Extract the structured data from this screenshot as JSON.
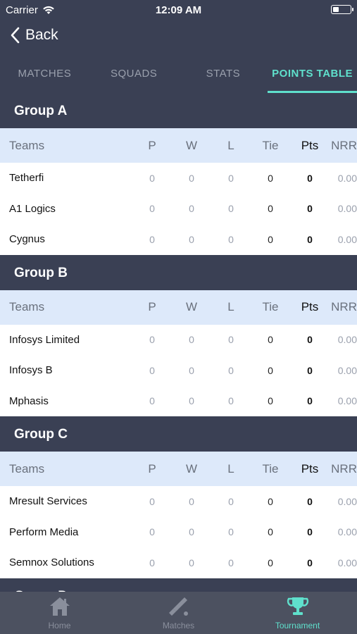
{
  "status_bar": {
    "carrier": "Carrier",
    "time": "12:09 AM"
  },
  "nav": {
    "back_label": "Back"
  },
  "tabs": [
    {
      "label": "MATCHES",
      "active": false
    },
    {
      "label": "SQUADS",
      "active": false
    },
    {
      "label": "STATS",
      "active": false
    },
    {
      "label": "POINTS TABLE",
      "active": true
    }
  ],
  "table_headers": {
    "team": "Teams",
    "p": "P",
    "w": "W",
    "l": "L",
    "tie": "Tie",
    "pts": "Pts",
    "nrr": "NRR"
  },
  "groups": [
    {
      "name": "Group A",
      "teams": [
        {
          "name": "Tetherfi",
          "p": "0",
          "w": "0",
          "l": "0",
          "tie": "0",
          "pts": "0",
          "nrr": "0.00"
        },
        {
          "name": "A1 Logics",
          "p": "0",
          "w": "0",
          "l": "0",
          "tie": "0",
          "pts": "0",
          "nrr": "0.00"
        },
        {
          "name": "Cygnus",
          "p": "0",
          "w": "0",
          "l": "0",
          "tie": "0",
          "pts": "0",
          "nrr": "0.00"
        }
      ]
    },
    {
      "name": "Group B",
      "teams": [
        {
          "name": "Infosys Limited",
          "p": "0",
          "w": "0",
          "l": "0",
          "tie": "0",
          "pts": "0",
          "nrr": "0.00"
        },
        {
          "name": "Infosys B",
          "p": "0",
          "w": "0",
          "l": "0",
          "tie": "0",
          "pts": "0",
          "nrr": "0.00"
        },
        {
          "name": "Mphasis",
          "p": "0",
          "w": "0",
          "l": "0",
          "tie": "0",
          "pts": "0",
          "nrr": "0.00"
        }
      ]
    },
    {
      "name": "Group C",
      "teams": [
        {
          "name": "Mresult Services",
          "p": "0",
          "w": "0",
          "l": "0",
          "tie": "0",
          "pts": "0",
          "nrr": "0.00"
        },
        {
          "name": "Perform Media",
          "p": "0",
          "w": "0",
          "l": "0",
          "tie": "0",
          "pts": "0",
          "nrr": "0.00"
        },
        {
          "name": "Semnox Solutions",
          "p": "0",
          "w": "0",
          "l": "0",
          "tie": "0",
          "pts": "0",
          "nrr": "0.00"
        }
      ]
    },
    {
      "name": "Group D",
      "teams": []
    }
  ],
  "bottom_tabs": [
    {
      "label": "Home",
      "icon": "home-icon",
      "active": false
    },
    {
      "label": "Matches",
      "icon": "cricket-bat-icon",
      "active": false
    },
    {
      "label": "Tournament",
      "icon": "trophy-icon",
      "active": true
    }
  ],
  "colors": {
    "accent": "#5fe0cc",
    "header_bg": "#3a4054",
    "table_head_bg": "#dde9fa"
  }
}
